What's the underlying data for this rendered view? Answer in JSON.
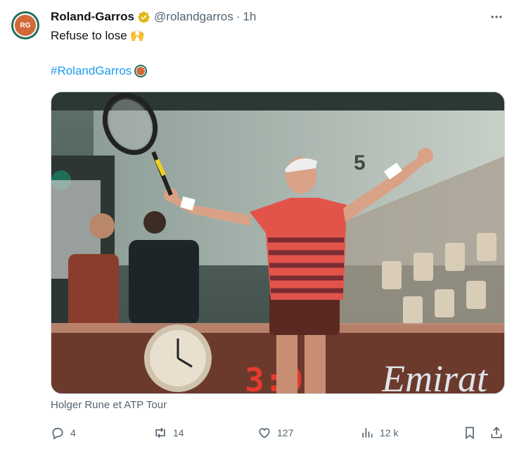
{
  "account": {
    "name": "Roland-Garros",
    "handle": "@rolandgarros",
    "separator": "·",
    "time": "1h"
  },
  "tweet": {
    "text": "Refuse to lose",
    "emoji": "🙌",
    "hashtag": "#RolandGarros"
  },
  "media": {
    "scoreboard": "3:9",
    "sponsor": "Emirat"
  },
  "caption": "Holger Rune et ATP Tour",
  "actions": {
    "replies": "4",
    "reposts": "14",
    "likes": "127",
    "views": "12 k"
  },
  "colors": {
    "link": "#1d9bf0",
    "muted": "#536471",
    "brand_green": "#1f6e5a",
    "clay": "#d2693b"
  }
}
